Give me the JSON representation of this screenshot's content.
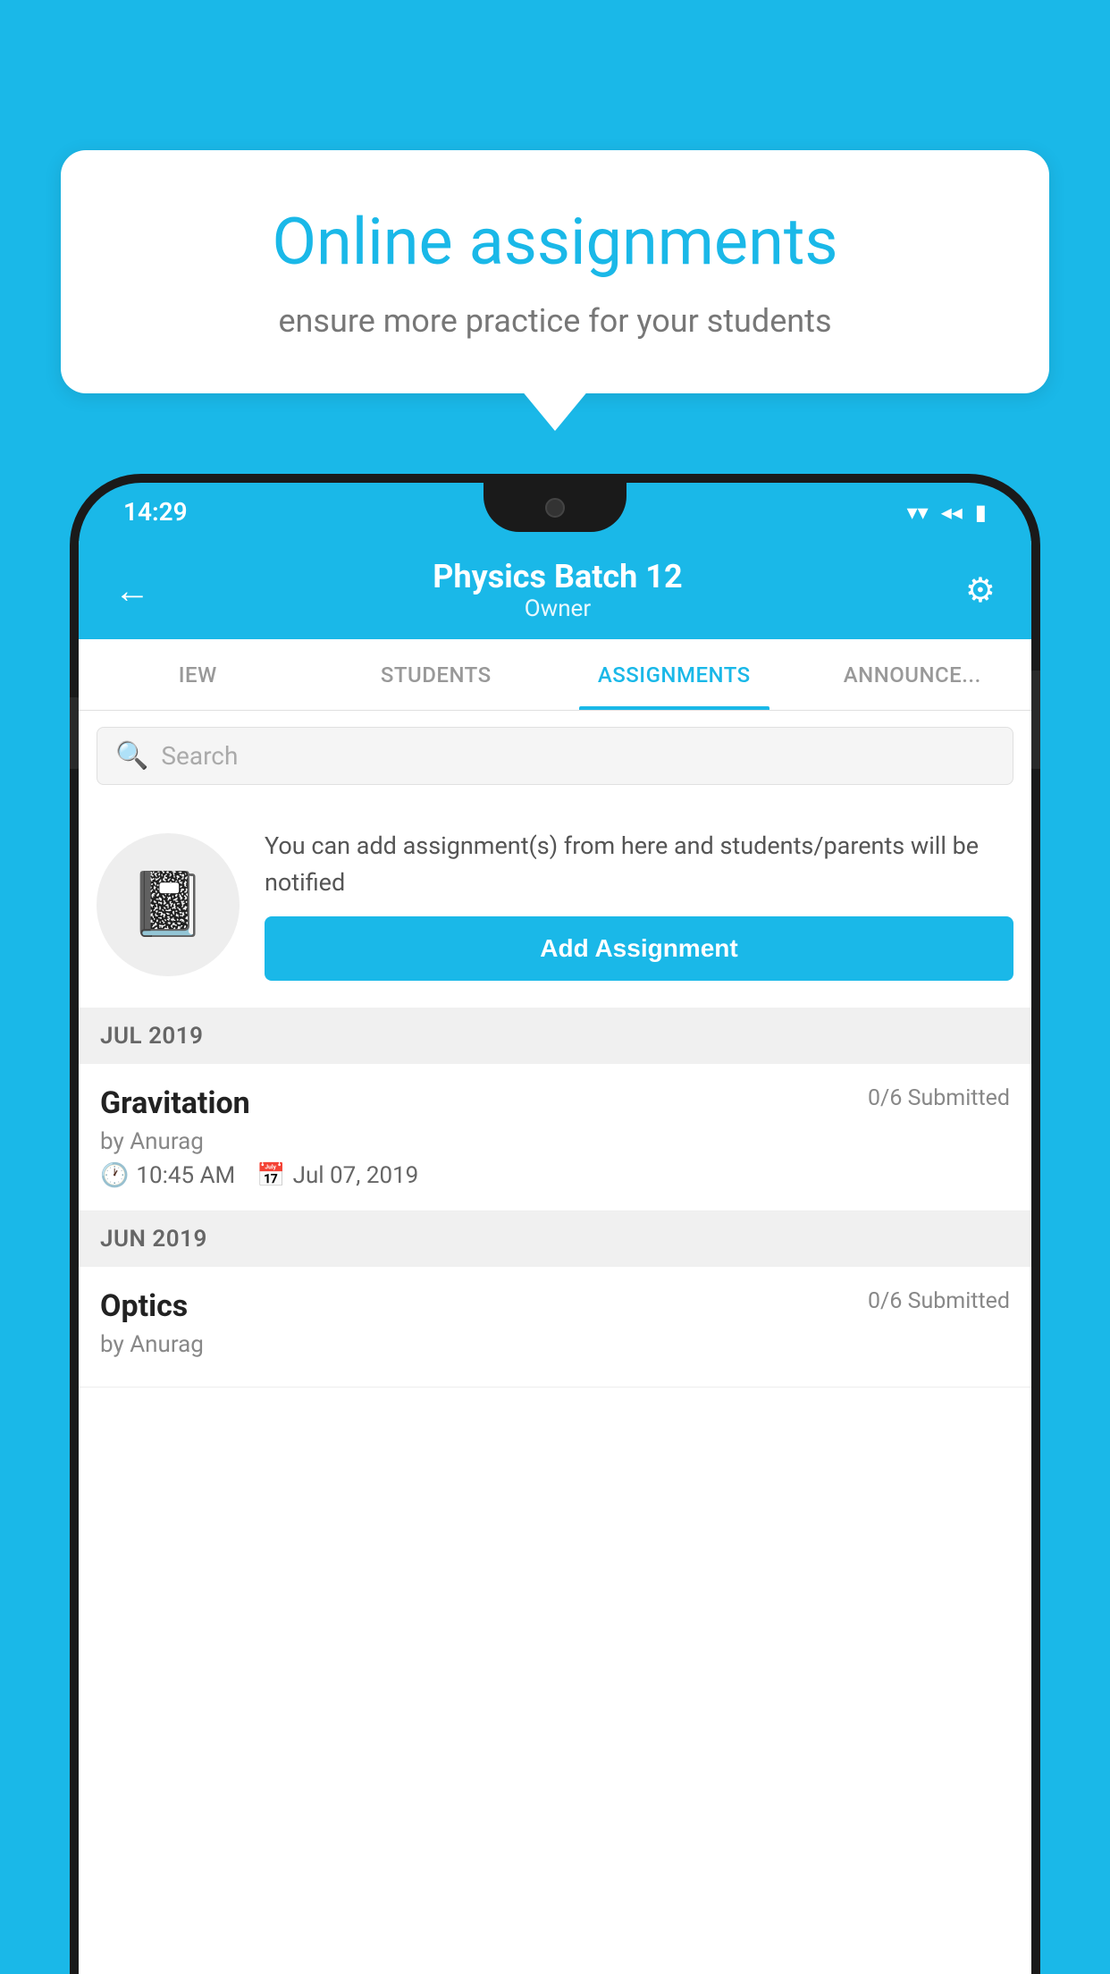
{
  "background_color": "#1ab8e8",
  "promo": {
    "title": "Online assignments",
    "subtitle": "ensure more practice for your students"
  },
  "status_bar": {
    "time": "14:29",
    "wifi_icon": "▾",
    "signal_icon": "◂",
    "battery_icon": "▮"
  },
  "app_bar": {
    "title": "Physics Batch 12",
    "subtitle": "Owner",
    "back_label": "←",
    "settings_label": "⚙"
  },
  "tabs": [
    {
      "id": "iew",
      "label": "IEW",
      "active": false
    },
    {
      "id": "students",
      "label": "STUDENTS",
      "active": false
    },
    {
      "id": "assignments",
      "label": "ASSIGNMENTS",
      "active": true
    },
    {
      "id": "announcements",
      "label": "ANNOUNCE...",
      "active": false
    }
  ],
  "search": {
    "placeholder": "Search"
  },
  "info_section": {
    "description": "You can add assignment(s) from here and students/parents will be notified",
    "add_button_label": "Add Assignment"
  },
  "months": [
    {
      "label": "JUL 2019",
      "assignments": [
        {
          "title": "Gravitation",
          "submitted": "0/6 Submitted",
          "author": "by Anurag",
          "time": "10:45 AM",
          "date": "Jul 07, 2019"
        }
      ]
    },
    {
      "label": "JUN 2019",
      "assignments": [
        {
          "title": "Optics",
          "submitted": "0/6 Submitted",
          "author": "by Anurag",
          "time": "",
          "date": ""
        }
      ]
    }
  ]
}
